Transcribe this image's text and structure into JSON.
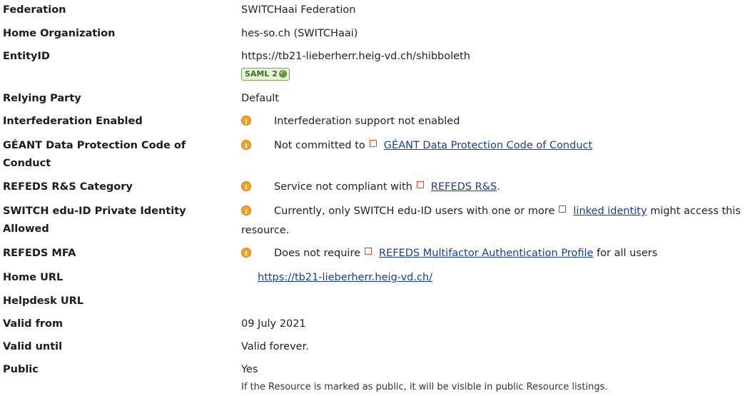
{
  "rows": {
    "federation": {
      "label": "Federation",
      "value": "SWITCHaai Federation"
    },
    "home_org": {
      "label": "Home Organization",
      "value": "hes-so.ch (SWITCHaai)"
    },
    "entity_id": {
      "label": "EntityID",
      "value": "https://tb21-lieberherr.heig-vd.ch/shibboleth",
      "badge": "SAML 2"
    },
    "relying_party": {
      "label": "Relying Party",
      "value": "Default"
    },
    "interfed": {
      "label": "Interfederation Enabled",
      "message": "Interfederation support not enabled"
    },
    "geant": {
      "label_line1": "GÉANT Data Protection Code of",
      "label_line2": "Conduct",
      "message_prefix": "Not committed to",
      "link": "GÉANT Data Protection Code of Conduct"
    },
    "refeds_rs": {
      "label": "REFEDS R&S Category",
      "message_prefix": "Service not compliant with",
      "link": "REFEDS R&S",
      "suffix": "."
    },
    "eduid": {
      "label_line1": "SWITCH edu-ID Private Identity",
      "label_line2": "Allowed",
      "message_prefix": "Currently, only SWITCH edu-ID users with one or more",
      "link": "linked identity",
      "suffix": "might access this",
      "continuation": "resource."
    },
    "refeds_mfa": {
      "label": "REFEDS MFA",
      "message_prefix": "Does not require",
      "link": "REFEDS Multifactor Authentication Profile",
      "suffix": "for all users"
    },
    "home_url": {
      "label": "Home URL",
      "link": "https://tb21-lieberherr.heig-vd.ch/"
    },
    "helpdesk_url": {
      "label": "Helpdesk URL",
      "value": ""
    },
    "valid_from": {
      "label": "Valid from",
      "value": "09 July 2021"
    },
    "valid_until": {
      "label": "Valid until",
      "value": "Valid forever."
    },
    "public": {
      "label": "Public",
      "value": "Yes",
      "note": "If the Resource is marked as public, it will be visible in public Resource listings."
    }
  },
  "colors": {
    "warning": "#f4a32a",
    "link": "#1a3e8a",
    "badge_green": "#5aa02c"
  },
  "icons": {
    "warning": "warning-icon",
    "external_link": "external-link-icon",
    "check": "check-icon"
  }
}
